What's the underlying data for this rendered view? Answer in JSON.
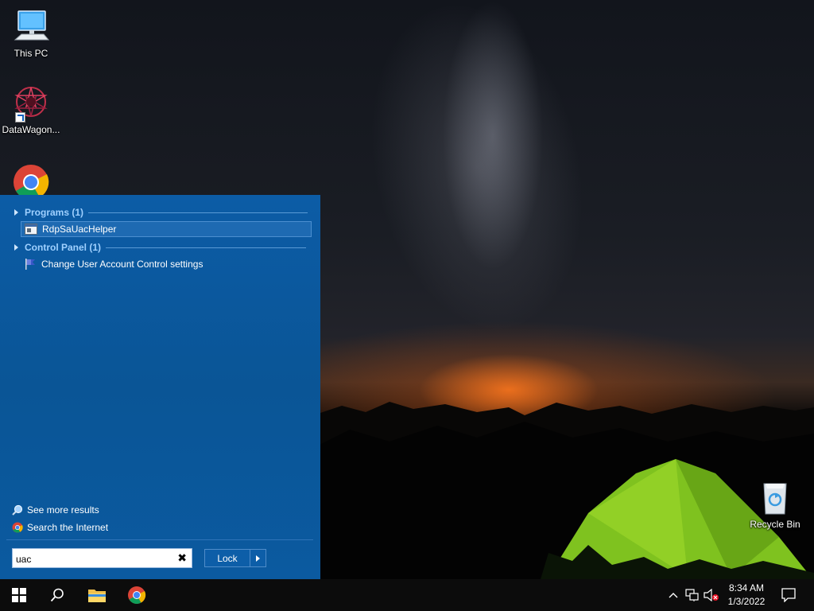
{
  "desktop": {
    "icons": [
      {
        "label": "This PC"
      },
      {
        "label": "DataWagon..."
      },
      {
        "label": ""
      },
      {
        "label": "Recycle Bin"
      }
    ]
  },
  "search_panel": {
    "groups": [
      {
        "header": "Programs (1)",
        "items": [
          {
            "label": "RdpSaUacHelper",
            "icon": "app-window-icon",
            "selected": true
          }
        ]
      },
      {
        "header": "Control Panel (1)",
        "items": [
          {
            "label": "Change User Account Control settings",
            "icon": "uac-flag-icon",
            "selected": false
          }
        ]
      }
    ],
    "see_more": "See more results",
    "search_internet": "Search the Internet",
    "search_input_value": "uac",
    "lock_label": "Lock"
  },
  "taskbar": {
    "time": "8:34 AM",
    "date": "1/3/2022"
  },
  "colors": {
    "panel": "#0b5aa0",
    "group_header": "#9fd0ff",
    "taskbar": "#0c0c0c"
  }
}
